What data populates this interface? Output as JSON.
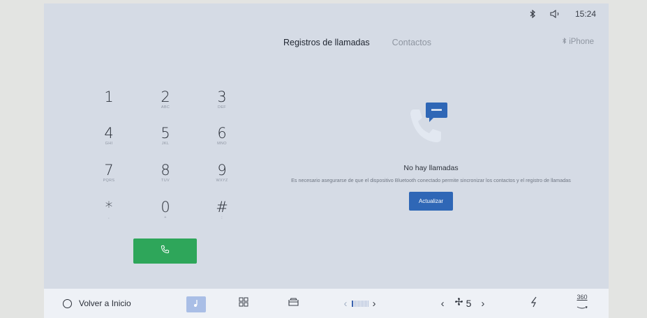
{
  "status": {
    "bluetooth_icon": "bluetooth-icon",
    "volume_icon": "speaker-icon",
    "time": "15:24"
  },
  "tabs": [
    {
      "label": "Registros de llamadas",
      "active": true
    },
    {
      "label": "Contactos",
      "active": false
    }
  ],
  "device": {
    "icon": "bluetooth-icon",
    "name": "iPhone"
  },
  "keypad": [
    {
      "digit": "1",
      "letters": ""
    },
    {
      "digit": "2",
      "letters": "ABC"
    },
    {
      "digit": "3",
      "letters": "DEF"
    },
    {
      "digit": "4",
      "letters": "GHI"
    },
    {
      "digit": "5",
      "letters": "JKL"
    },
    {
      "digit": "6",
      "letters": "MNO"
    },
    {
      "digit": "7",
      "letters": "PQRS"
    },
    {
      "digit": "8",
      "letters": "TUV"
    },
    {
      "digit": "9",
      "letters": "WXYZ"
    },
    {
      "digit": "*",
      "letters": ","
    },
    {
      "digit": "0",
      "letters": "+"
    },
    {
      "digit": "#",
      "letters": ";"
    }
  ],
  "call_button": {
    "icon": "phone-icon",
    "color": "#2ea65a"
  },
  "empty_state": {
    "icon": "call-log-icon",
    "title": "No hay llamadas",
    "description": "Es necesario asegurarse de que el dispositivo Bluetooth conectado permite sincronizar los contactos y el registro de llamadas",
    "button": "Actualizar",
    "button_color": "#2f67b6"
  },
  "bottom_bar": {
    "home_label": "Volver a Inicio",
    "music_icon": "music-note-icon",
    "apps_icon": "grid-icon",
    "seat_icon": "seat-icon",
    "temperature_level": 0.1,
    "fan_speed": "5",
    "fan_icon": "fan-icon",
    "flash_icon": "lightning-icon",
    "camera_label": "360"
  }
}
